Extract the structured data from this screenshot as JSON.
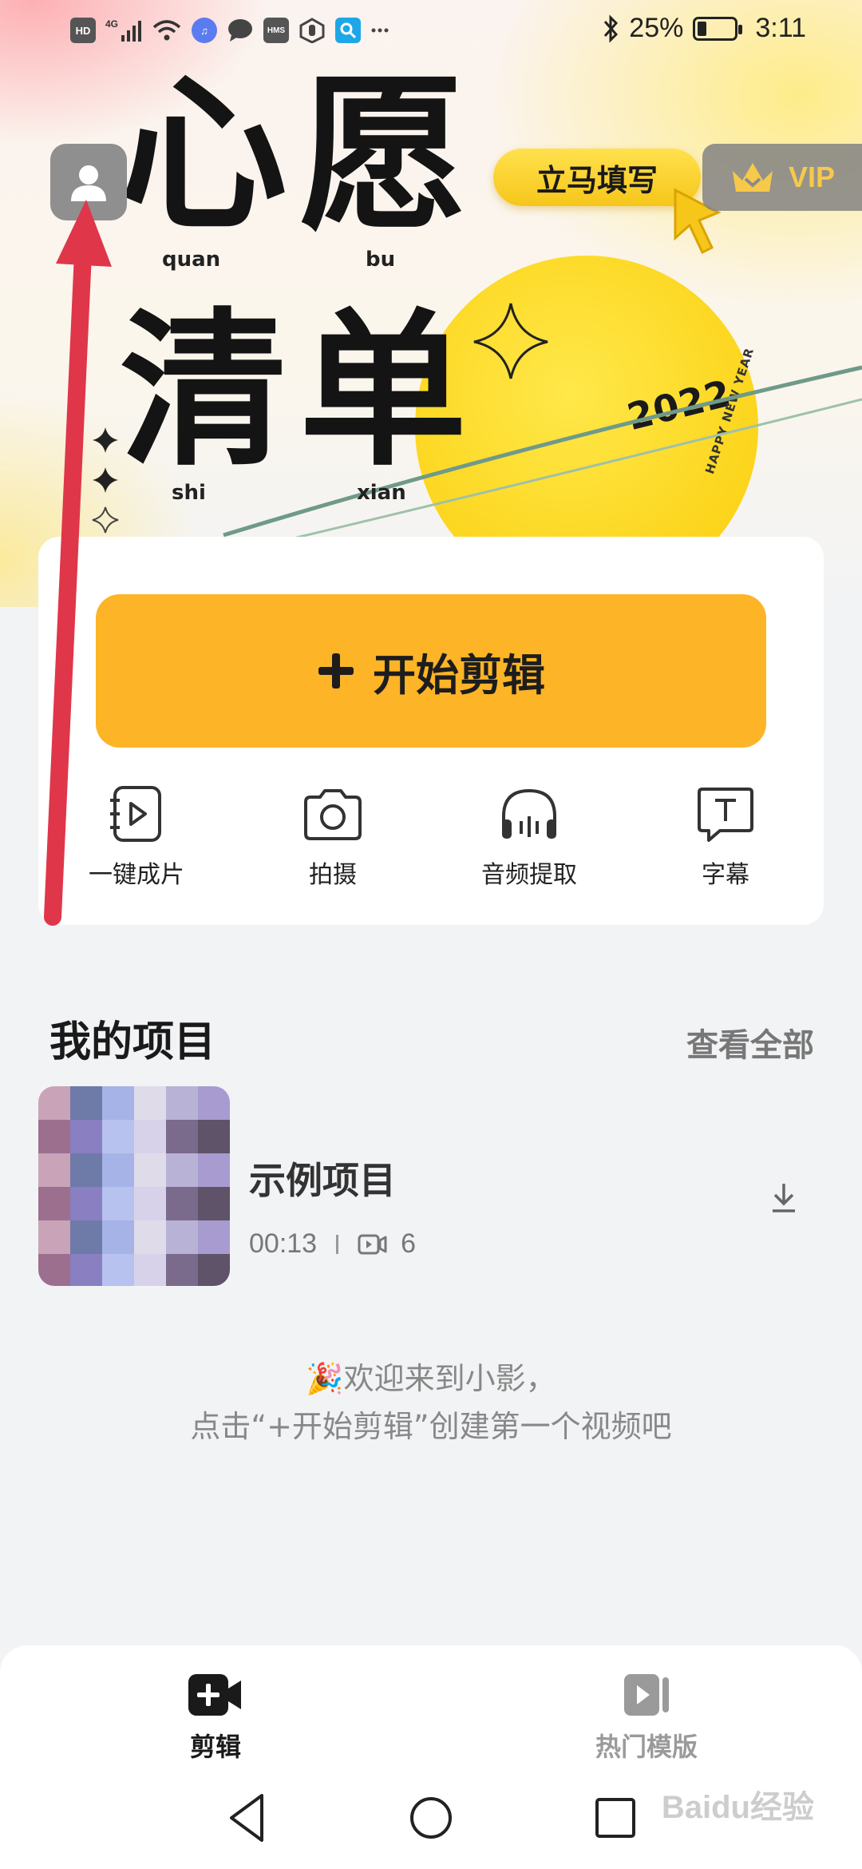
{
  "status_bar": {
    "left_icons": [
      "HD",
      "4G",
      "signal-icon",
      "wifi-icon",
      "music-icon",
      "chat-icon",
      "HMS",
      "hand-icon",
      "search-icon",
      "more-icon"
    ],
    "hd": "HD",
    "hms": "HMS",
    "battery_text": "25%",
    "battery_level": 0.25,
    "time": "3:11"
  },
  "banner": {
    "char1": "心",
    "char2": "愿",
    "char3": "清",
    "char4": "单",
    "pinyin1": "quan",
    "pinyin2": "bu",
    "pinyin3": "shi",
    "pinyin4": "xian",
    "year": "2022",
    "new_year": "HAPPY NEW YEAR",
    "fill_button": "立马填写",
    "vip_label": "VIP"
  },
  "card": {
    "start_button": "开始剪辑",
    "tools": [
      {
        "label": "一键成片",
        "icon": "auto-film-icon"
      },
      {
        "label": "拍摄",
        "icon": "camera-icon"
      },
      {
        "label": "音频提取",
        "icon": "headphones-icon"
      },
      {
        "label": "字幕",
        "icon": "subtitle-icon"
      }
    ]
  },
  "projects": {
    "title": "我的项目",
    "see_all": "查看全部",
    "items": [
      {
        "name": "示例项目",
        "duration": "00:13",
        "clip_count": "6"
      }
    ]
  },
  "welcome": {
    "line1": "🎉欢迎来到小影，",
    "line2": "点击“+开始剪辑”创建第一个视频吧"
  },
  "bottom_nav": {
    "items": [
      {
        "label": "剪辑",
        "icon": "video-add-icon",
        "active": true
      },
      {
        "label": "热门模版",
        "icon": "template-icon",
        "active": false
      }
    ]
  },
  "watermark": "Baidu经验",
  "colors": {
    "accent": "#fdb426",
    "annotation_arrow": "#e0364a",
    "active_nav": "#1a1a1a",
    "inactive_nav": "#9a9a9a"
  }
}
